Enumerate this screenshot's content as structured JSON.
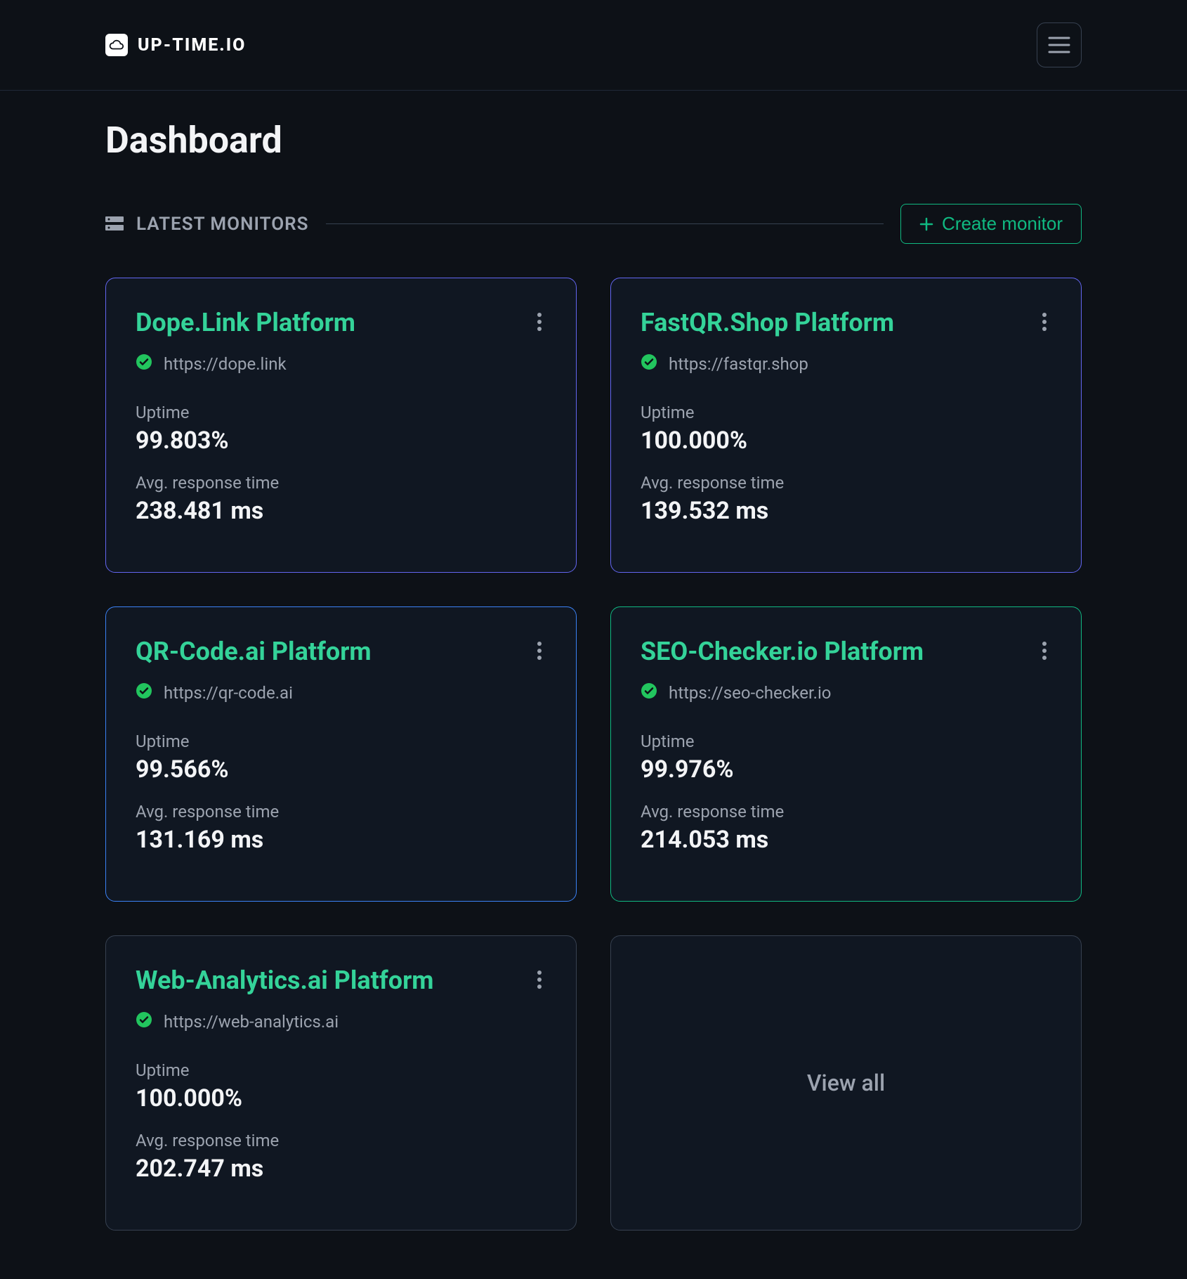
{
  "brand": "UP-TIME.IO",
  "pageTitle": "Dashboard",
  "sectionLabel": "LATEST MONITORS",
  "createLabel": "Create monitor",
  "uptimeLabel": "Uptime",
  "respLabel": "Avg. response time",
  "viewAll": "View all",
  "monitors": [
    {
      "title": "Dope.Link Platform",
      "url": "https://dope.link",
      "uptime": "99.803%",
      "resp": "238.481 ms",
      "border": "purple"
    },
    {
      "title": "FastQR.Shop Platform",
      "url": "https://fastqr.shop",
      "uptime": "100.000%",
      "resp": "139.532 ms",
      "border": "purple"
    },
    {
      "title": "QR-Code.ai Platform",
      "url": "https://qr-code.ai",
      "uptime": "99.566%",
      "resp": "131.169 ms",
      "border": "blue"
    },
    {
      "title": "SEO-Checker.io Platform",
      "url": "https://seo-checker.io",
      "uptime": "99.976%",
      "resp": "214.053 ms",
      "border": "green"
    },
    {
      "title": "Web-Analytics.ai Platform",
      "url": "https://web-analytics.ai",
      "uptime": "100.000%",
      "resp": "202.747 ms",
      "border": ""
    }
  ]
}
